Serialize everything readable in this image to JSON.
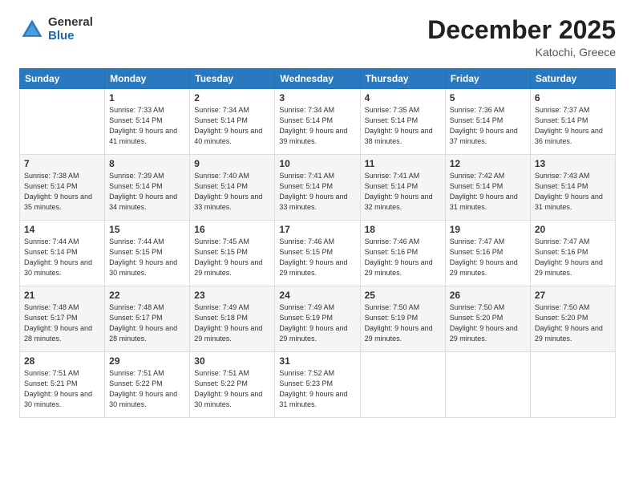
{
  "logo": {
    "general": "General",
    "blue": "Blue"
  },
  "header": {
    "month": "December 2025",
    "location": "Katochi, Greece"
  },
  "days": [
    "Sunday",
    "Monday",
    "Tuesday",
    "Wednesday",
    "Thursday",
    "Friday",
    "Saturday"
  ],
  "weeks": [
    [
      {
        "num": "",
        "sunrise": "",
        "sunset": "",
        "daylight": ""
      },
      {
        "num": "1",
        "sunrise": "Sunrise: 7:33 AM",
        "sunset": "Sunset: 5:14 PM",
        "daylight": "Daylight: 9 hours and 41 minutes."
      },
      {
        "num": "2",
        "sunrise": "Sunrise: 7:34 AM",
        "sunset": "Sunset: 5:14 PM",
        "daylight": "Daylight: 9 hours and 40 minutes."
      },
      {
        "num": "3",
        "sunrise": "Sunrise: 7:34 AM",
        "sunset": "Sunset: 5:14 PM",
        "daylight": "Daylight: 9 hours and 39 minutes."
      },
      {
        "num": "4",
        "sunrise": "Sunrise: 7:35 AM",
        "sunset": "Sunset: 5:14 PM",
        "daylight": "Daylight: 9 hours and 38 minutes."
      },
      {
        "num": "5",
        "sunrise": "Sunrise: 7:36 AM",
        "sunset": "Sunset: 5:14 PM",
        "daylight": "Daylight: 9 hours and 37 minutes."
      },
      {
        "num": "6",
        "sunrise": "Sunrise: 7:37 AM",
        "sunset": "Sunset: 5:14 PM",
        "daylight": "Daylight: 9 hours and 36 minutes."
      }
    ],
    [
      {
        "num": "7",
        "sunrise": "Sunrise: 7:38 AM",
        "sunset": "Sunset: 5:14 PM",
        "daylight": "Daylight: 9 hours and 35 minutes."
      },
      {
        "num": "8",
        "sunrise": "Sunrise: 7:39 AM",
        "sunset": "Sunset: 5:14 PM",
        "daylight": "Daylight: 9 hours and 34 minutes."
      },
      {
        "num": "9",
        "sunrise": "Sunrise: 7:40 AM",
        "sunset": "Sunset: 5:14 PM",
        "daylight": "Daylight: 9 hours and 33 minutes."
      },
      {
        "num": "10",
        "sunrise": "Sunrise: 7:41 AM",
        "sunset": "Sunset: 5:14 PM",
        "daylight": "Daylight: 9 hours and 33 minutes."
      },
      {
        "num": "11",
        "sunrise": "Sunrise: 7:41 AM",
        "sunset": "Sunset: 5:14 PM",
        "daylight": "Daylight: 9 hours and 32 minutes."
      },
      {
        "num": "12",
        "sunrise": "Sunrise: 7:42 AM",
        "sunset": "Sunset: 5:14 PM",
        "daylight": "Daylight: 9 hours and 31 minutes."
      },
      {
        "num": "13",
        "sunrise": "Sunrise: 7:43 AM",
        "sunset": "Sunset: 5:14 PM",
        "daylight": "Daylight: 9 hours and 31 minutes."
      }
    ],
    [
      {
        "num": "14",
        "sunrise": "Sunrise: 7:44 AM",
        "sunset": "Sunset: 5:14 PM",
        "daylight": "Daylight: 9 hours and 30 minutes."
      },
      {
        "num": "15",
        "sunrise": "Sunrise: 7:44 AM",
        "sunset": "Sunset: 5:15 PM",
        "daylight": "Daylight: 9 hours and 30 minutes."
      },
      {
        "num": "16",
        "sunrise": "Sunrise: 7:45 AM",
        "sunset": "Sunset: 5:15 PM",
        "daylight": "Daylight: 9 hours and 29 minutes."
      },
      {
        "num": "17",
        "sunrise": "Sunrise: 7:46 AM",
        "sunset": "Sunset: 5:15 PM",
        "daylight": "Daylight: 9 hours and 29 minutes."
      },
      {
        "num": "18",
        "sunrise": "Sunrise: 7:46 AM",
        "sunset": "Sunset: 5:16 PM",
        "daylight": "Daylight: 9 hours and 29 minutes."
      },
      {
        "num": "19",
        "sunrise": "Sunrise: 7:47 AM",
        "sunset": "Sunset: 5:16 PM",
        "daylight": "Daylight: 9 hours and 29 minutes."
      },
      {
        "num": "20",
        "sunrise": "Sunrise: 7:47 AM",
        "sunset": "Sunset: 5:16 PM",
        "daylight": "Daylight: 9 hours and 29 minutes."
      }
    ],
    [
      {
        "num": "21",
        "sunrise": "Sunrise: 7:48 AM",
        "sunset": "Sunset: 5:17 PM",
        "daylight": "Daylight: 9 hours and 28 minutes."
      },
      {
        "num": "22",
        "sunrise": "Sunrise: 7:48 AM",
        "sunset": "Sunset: 5:17 PM",
        "daylight": "Daylight: 9 hours and 28 minutes."
      },
      {
        "num": "23",
        "sunrise": "Sunrise: 7:49 AM",
        "sunset": "Sunset: 5:18 PM",
        "daylight": "Daylight: 9 hours and 29 minutes."
      },
      {
        "num": "24",
        "sunrise": "Sunrise: 7:49 AM",
        "sunset": "Sunset: 5:19 PM",
        "daylight": "Daylight: 9 hours and 29 minutes."
      },
      {
        "num": "25",
        "sunrise": "Sunrise: 7:50 AM",
        "sunset": "Sunset: 5:19 PM",
        "daylight": "Daylight: 9 hours and 29 minutes."
      },
      {
        "num": "26",
        "sunrise": "Sunrise: 7:50 AM",
        "sunset": "Sunset: 5:20 PM",
        "daylight": "Daylight: 9 hours and 29 minutes."
      },
      {
        "num": "27",
        "sunrise": "Sunrise: 7:50 AM",
        "sunset": "Sunset: 5:20 PM",
        "daylight": "Daylight: 9 hours and 29 minutes."
      }
    ],
    [
      {
        "num": "28",
        "sunrise": "Sunrise: 7:51 AM",
        "sunset": "Sunset: 5:21 PM",
        "daylight": "Daylight: 9 hours and 30 minutes."
      },
      {
        "num": "29",
        "sunrise": "Sunrise: 7:51 AM",
        "sunset": "Sunset: 5:22 PM",
        "daylight": "Daylight: 9 hours and 30 minutes."
      },
      {
        "num": "30",
        "sunrise": "Sunrise: 7:51 AM",
        "sunset": "Sunset: 5:22 PM",
        "daylight": "Daylight: 9 hours and 30 minutes."
      },
      {
        "num": "31",
        "sunrise": "Sunrise: 7:52 AM",
        "sunset": "Sunset: 5:23 PM",
        "daylight": "Daylight: 9 hours and 31 minutes."
      },
      {
        "num": "",
        "sunrise": "",
        "sunset": "",
        "daylight": ""
      },
      {
        "num": "",
        "sunrise": "",
        "sunset": "",
        "daylight": ""
      },
      {
        "num": "",
        "sunrise": "",
        "sunset": "",
        "daylight": ""
      }
    ]
  ]
}
